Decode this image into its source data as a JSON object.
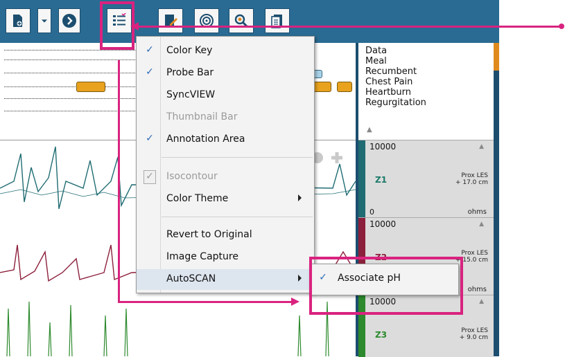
{
  "menu": {
    "items": [
      {
        "label": "Color Key",
        "checked": true
      },
      {
        "label": "Probe Bar",
        "checked": true
      },
      {
        "label": "SyncVIEW",
        "checked": false
      },
      {
        "label": "Thumbnail Bar",
        "checked": false,
        "disabled": true
      },
      {
        "label": "Annotation Area",
        "checked": true
      },
      {
        "label": "Isocontour",
        "checked": true,
        "disabled": true
      },
      {
        "label": "Color Theme",
        "submenu": true
      },
      {
        "label": "Revert to Original"
      },
      {
        "label": "Image Capture"
      },
      {
        "label": "AutoSCAN",
        "submenu": true,
        "highlighted": true
      }
    ],
    "check_glyph": "✓"
  },
  "submenu": {
    "items": [
      {
        "label": "Associate pH",
        "checked": true
      }
    ]
  },
  "legend": {
    "items": [
      "Data",
      "Meal",
      "Recumbent",
      "Chest Pain",
      "Heartburn",
      "Regurgitation"
    ]
  },
  "channels": [
    {
      "max": "10000",
      "min": "0",
      "name": "Z1",
      "location": "Prox LES\n+ 17.0 cm",
      "units": "ohms",
      "color": "#1f6c72"
    },
    {
      "max": "10000",
      "min": "",
      "name": "Z2",
      "location": "Prox LES\n+ 15.0 cm",
      "units": "ohms",
      "color": "#8c1f3b"
    },
    {
      "max": "10000",
      "min": "",
      "name": "Z3",
      "location": "Prox LES\n+ 9.0 cm",
      "units": "",
      "color": "#2d8a2d"
    }
  ],
  "toolbar": {
    "icons": [
      "new-document-icon",
      "dropdown-arrow-icon",
      "next-icon",
      "view-options-icon",
      "edit-icon",
      "target-icon",
      "search-icon",
      "clipboard-icon"
    ]
  },
  "colors": {
    "toolbar": "#2a6b93",
    "highlight": "#d9237f",
    "check": "#2c6bb5",
    "marker_orange": "#e8a21e",
    "marker_blue": "#a9d2e6"
  }
}
